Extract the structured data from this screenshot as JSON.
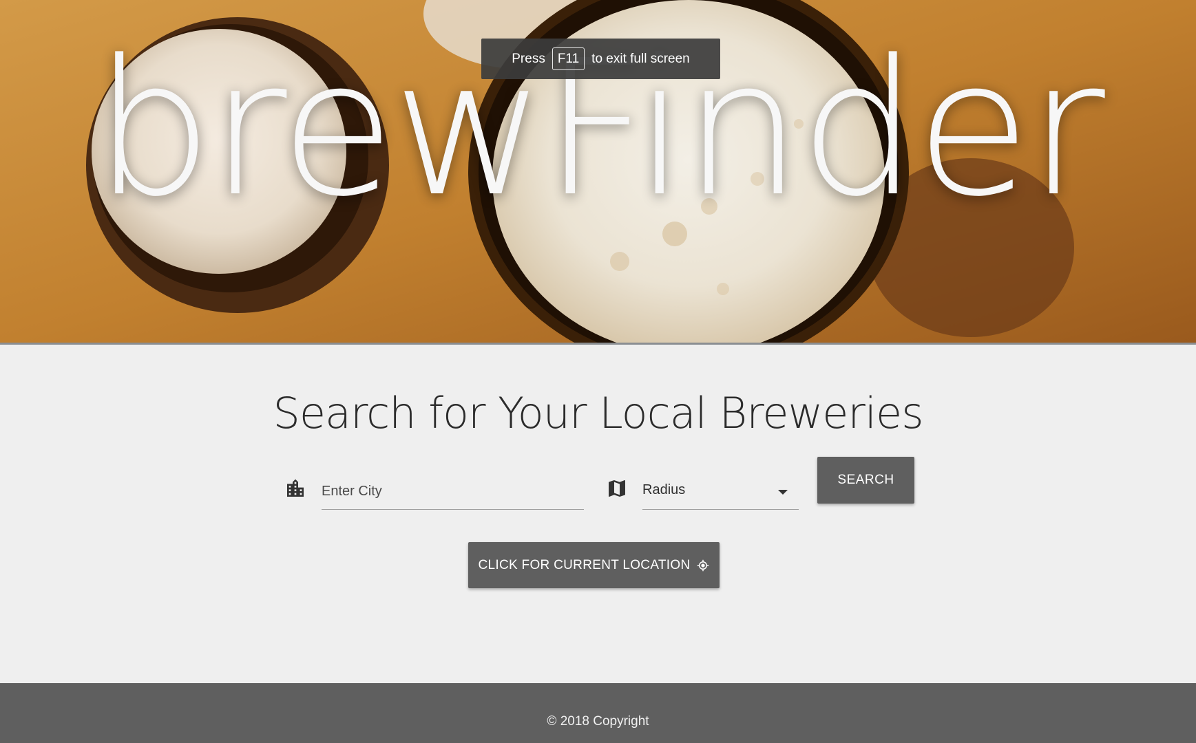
{
  "hero": {
    "brand_title": "brewFinder",
    "fullscreen_notice": {
      "prefix": "Press",
      "key": "F11",
      "suffix": "to exit full screen"
    }
  },
  "search": {
    "heading": "Search for Your Local Breweries",
    "city": {
      "placeholder": "Enter City",
      "value": "",
      "icon": "city-icon"
    },
    "radius": {
      "selected": "Radius",
      "icon": "map-icon"
    },
    "search_button_label": "SEARCH",
    "location_button_label": "CLICK FOR CURRENT LOCATION",
    "location_icon": "my-location-icon"
  },
  "footer": {
    "copyright": "© 2018 Copyright"
  },
  "colors": {
    "button_bg": "#5f5f5f",
    "page_bg": "#efefef",
    "footer_bg": "#5f5f5f",
    "hero_amber": "#c98a3a"
  }
}
